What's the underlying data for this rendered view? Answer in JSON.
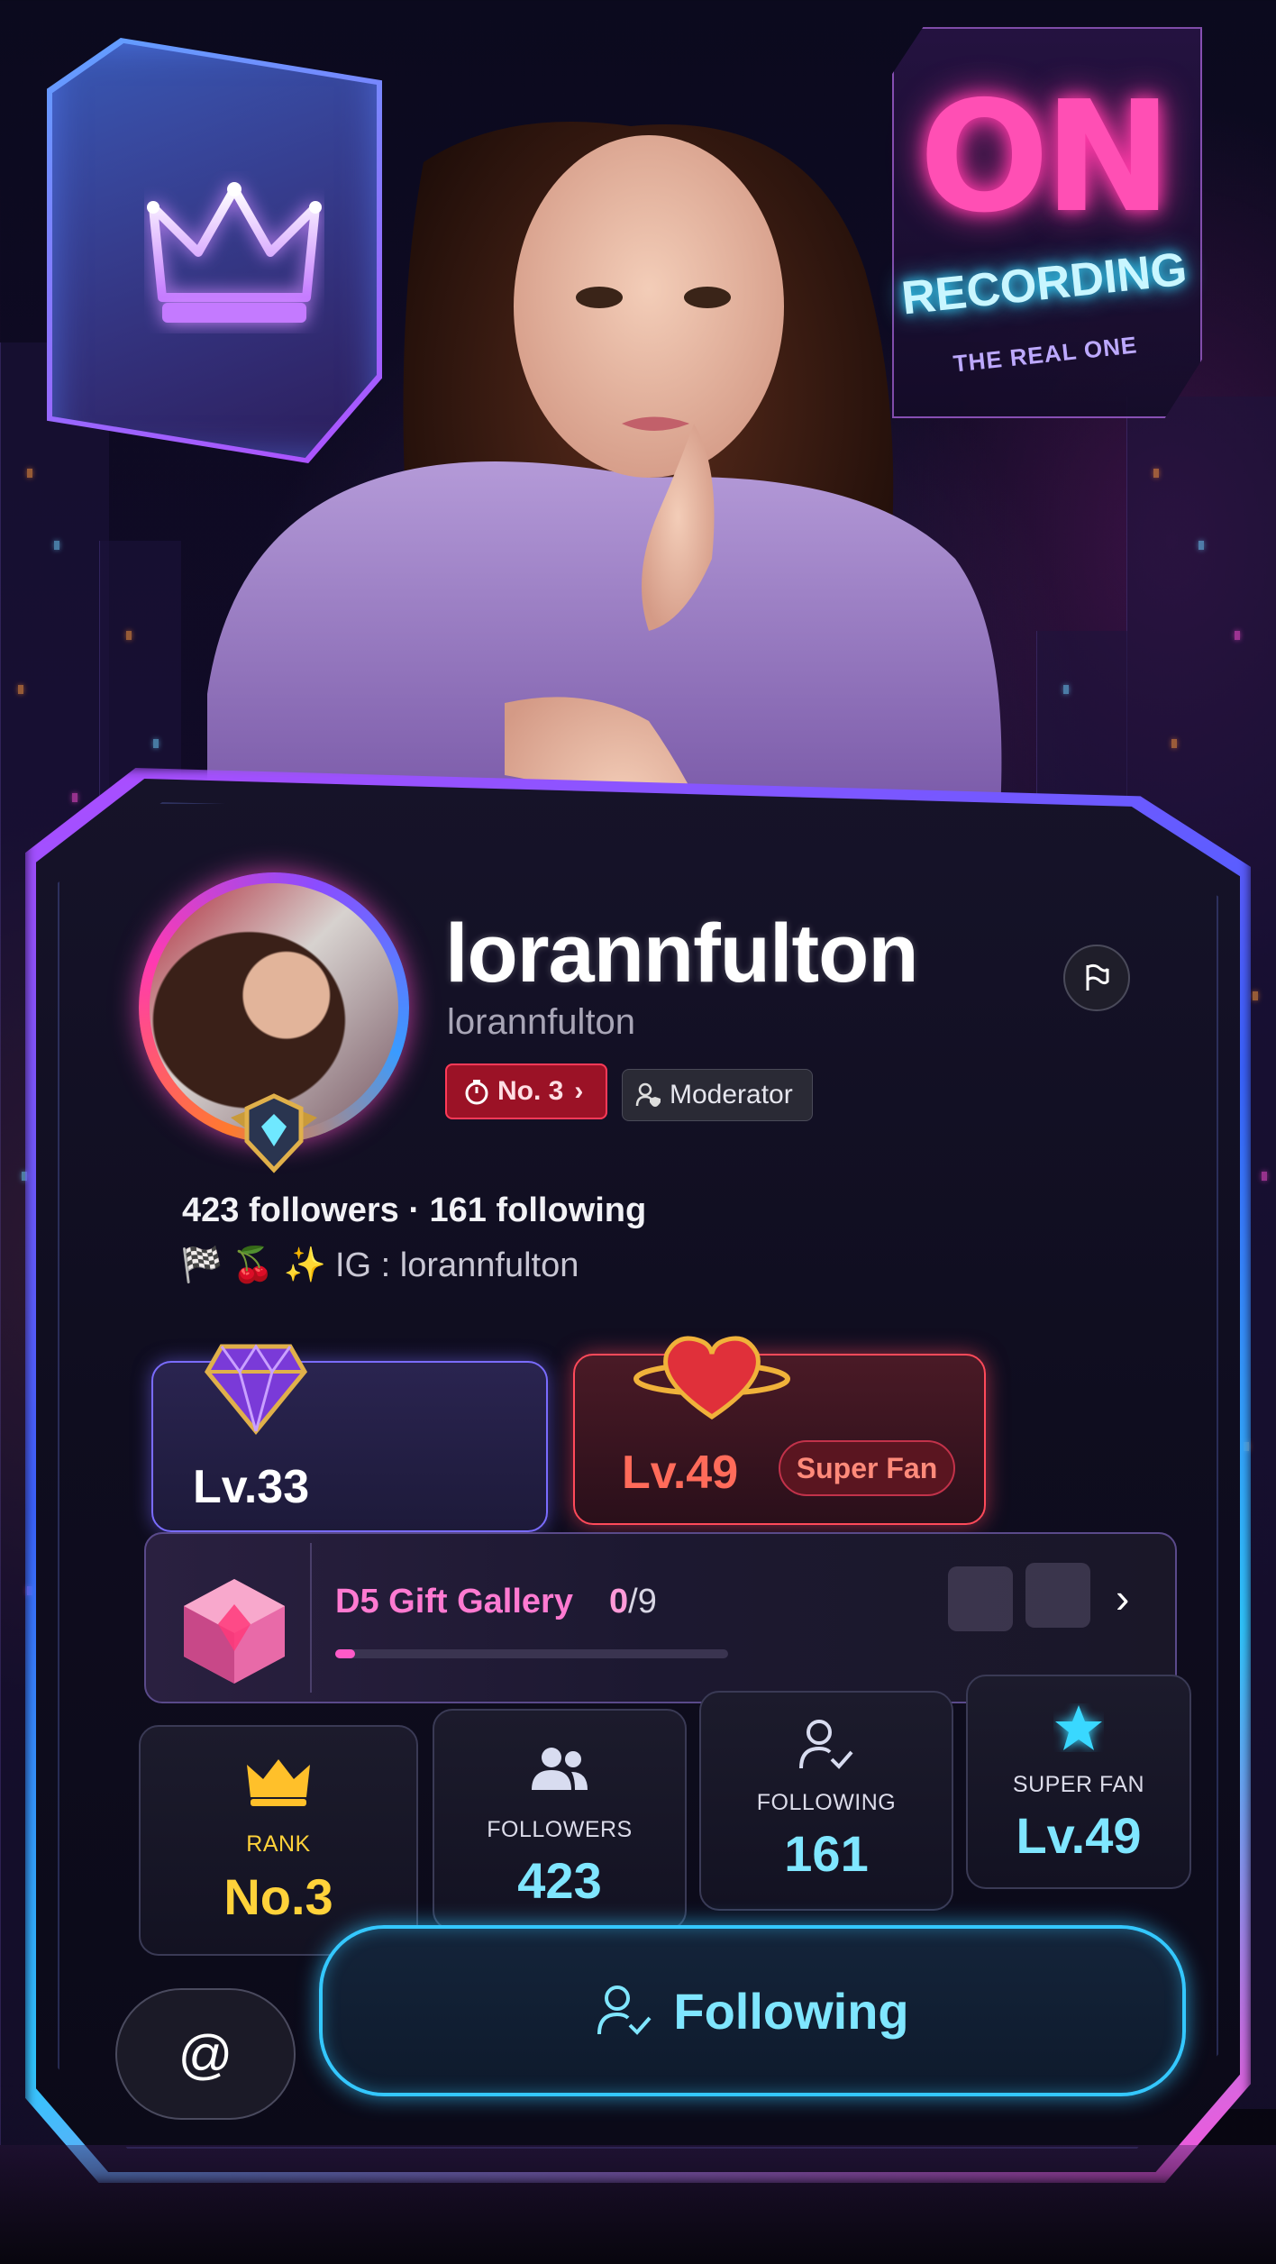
{
  "background": {
    "sign_left": {
      "icon": "crown-icon"
    },
    "sign_right": {
      "big_text": "ON",
      "label": "RECORDING",
      "sub": "THE REAL ONE"
    }
  },
  "profile": {
    "display_name": "lorannfulton",
    "handle": "lorannfulton",
    "rank_badge": {
      "icon": "stopwatch-icon",
      "label": "No. 3",
      "chevron": "›"
    },
    "role_badge": {
      "icon": "user-shield-icon",
      "label": "Moderator"
    },
    "report_button": {
      "icon": "flag-icon"
    },
    "follow_summary": "423 followers · 161 following",
    "bio": {
      "emojis": [
        "🏁",
        "🍒",
        "✨"
      ],
      "text": "IG : lorannfulton"
    }
  },
  "levels": {
    "gifter": {
      "icon": "diamond-icon",
      "label": "Lv.33"
    },
    "fan": {
      "icon": "heart-icon",
      "label": "Lv.49",
      "badge": "Super Fan"
    }
  },
  "gift_gallery": {
    "title": "D5 Gift Gallery",
    "collected": "0",
    "total": "/9",
    "progress": 0.05,
    "chevron": "›"
  },
  "stats": [
    {
      "icon": "crown-icon",
      "label": "RANK",
      "value": "No.3",
      "color": "#ffd23a"
    },
    {
      "icon": "users-icon",
      "label": "FOLLOWERS",
      "value": "423",
      "color": "#7fe6ff"
    },
    {
      "icon": "user-check-icon",
      "label": "FOLLOWING",
      "value": "161",
      "color": "#7fe6ff"
    },
    {
      "icon": "star-icon",
      "label": "SUPER FAN",
      "value": "Lv.49",
      "color": "#7fe6ff"
    }
  ],
  "actions": {
    "mention": {
      "label": "@"
    },
    "follow": {
      "icon": "user-check-icon",
      "label": "Following"
    }
  },
  "colors": {
    "accent_cyan": "#34c8ff",
    "accent_pink": "#ff3ab0",
    "rank_red": "#ff3a58",
    "gold": "#ffd23a"
  }
}
